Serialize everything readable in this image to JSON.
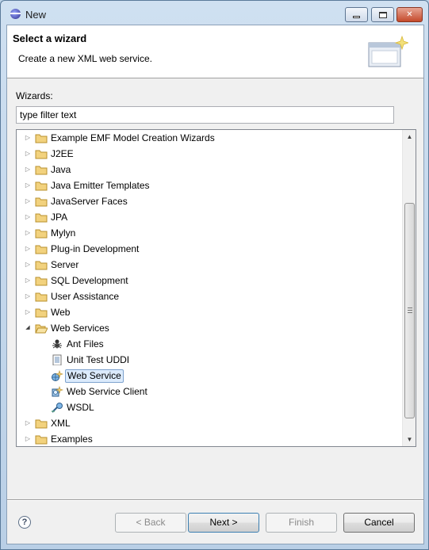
{
  "window": {
    "title": "New"
  },
  "header": {
    "title": "Select a wizard",
    "description": "Create a new XML web service."
  },
  "wizards_label": "Wizards:",
  "filter": {
    "value": "type filter text",
    "placeholder": "type filter text"
  },
  "tree": {
    "items": [
      {
        "label": "Example EMF Model Creation Wizards",
        "level": 0,
        "icon": "folder-icon",
        "expanded": false
      },
      {
        "label": "J2EE",
        "level": 0,
        "icon": "folder-icon",
        "expanded": false
      },
      {
        "label": "Java",
        "level": 0,
        "icon": "folder-icon",
        "expanded": false
      },
      {
        "label": "Java Emitter Templates",
        "level": 0,
        "icon": "folder-icon",
        "expanded": false
      },
      {
        "label": "JavaServer Faces",
        "level": 0,
        "icon": "folder-icon",
        "expanded": false
      },
      {
        "label": "JPA",
        "level": 0,
        "icon": "folder-icon",
        "expanded": false
      },
      {
        "label": "Mylyn",
        "level": 0,
        "icon": "folder-icon",
        "expanded": false
      },
      {
        "label": "Plug-in Development",
        "level": 0,
        "icon": "folder-icon",
        "expanded": false
      },
      {
        "label": "Server",
        "level": 0,
        "icon": "folder-icon",
        "expanded": false
      },
      {
        "label": "SQL Development",
        "level": 0,
        "icon": "folder-icon",
        "expanded": false
      },
      {
        "label": "User Assistance",
        "level": 0,
        "icon": "folder-icon",
        "expanded": false
      },
      {
        "label": "Web",
        "level": 0,
        "icon": "folder-icon",
        "expanded": false
      },
      {
        "label": "Web Services",
        "level": 0,
        "icon": "open-folder-icon",
        "expanded": true
      },
      {
        "label": "Ant Files",
        "level": 1,
        "icon": "ant-icon"
      },
      {
        "label": "Unit Test UDDI",
        "level": 1,
        "icon": "document-icon"
      },
      {
        "label": "Web Service",
        "level": 1,
        "icon": "web-service-icon",
        "selected": true
      },
      {
        "label": "Web Service Client",
        "level": 1,
        "icon": "web-service-client-icon"
      },
      {
        "label": "WSDL",
        "level": 1,
        "icon": "wsdl-icon"
      },
      {
        "label": "XML",
        "level": 0,
        "icon": "folder-icon",
        "expanded": false
      },
      {
        "label": "Examples",
        "level": 0,
        "icon": "folder-icon",
        "expanded": false
      }
    ]
  },
  "buttons": {
    "help": "?",
    "back": "< Back",
    "next": "Next >",
    "finish": "Finish",
    "cancel": "Cancel"
  },
  "colors": {
    "selection_bg": "#dcebfc",
    "selection_border": "#7da2ce",
    "folder": "#e8c76a"
  }
}
